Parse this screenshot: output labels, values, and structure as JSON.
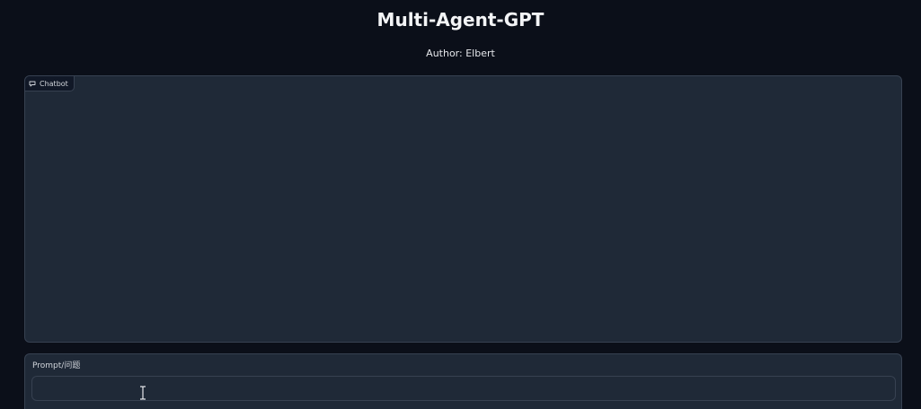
{
  "header": {
    "title": "Multi-Agent-GPT",
    "author": "Author: Elbert"
  },
  "chatbot": {
    "label": "Chatbot",
    "icon": "chat-bubble-icon"
  },
  "prompt": {
    "label": "Prompt/问题",
    "value": "",
    "placeholder": ""
  },
  "cursor": {
    "icon": "text-cursor-icon"
  },
  "colors": {
    "background": "#0b0f19",
    "panel": "#1f2937",
    "border": "#374151",
    "text": "#e5e7eb"
  }
}
